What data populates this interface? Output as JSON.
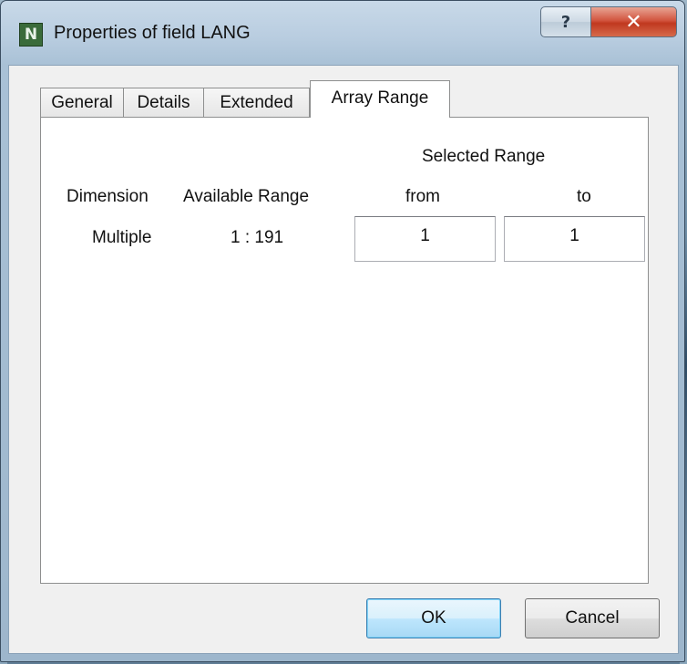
{
  "window": {
    "title": "Properties of field LANG",
    "app_icon_letter": "N",
    "help_glyph": "?",
    "close_glyph": "✕"
  },
  "tabs": [
    {
      "label": "General",
      "active": false
    },
    {
      "label": "Details",
      "active": false
    },
    {
      "label": "Extended",
      "active": false
    },
    {
      "label": "Array Range",
      "active": true
    }
  ],
  "array_range": {
    "selected_range_header": "Selected Range",
    "col_dimension": "Dimension",
    "col_available": "Available Range",
    "col_from": "from",
    "col_to": "to",
    "rows": [
      {
        "dimension": "Multiple",
        "available": "1 : 191",
        "from": "1",
        "to": "1"
      }
    ]
  },
  "buttons": {
    "ok": "OK",
    "cancel": "Cancel"
  },
  "colors": {
    "titlebar": "#b9cde0",
    "close_red": "#c0381f",
    "panel_bg": "#ffffff",
    "dialog_bg": "#f0f0f0",
    "default_button_border": "#3c7fb1"
  }
}
